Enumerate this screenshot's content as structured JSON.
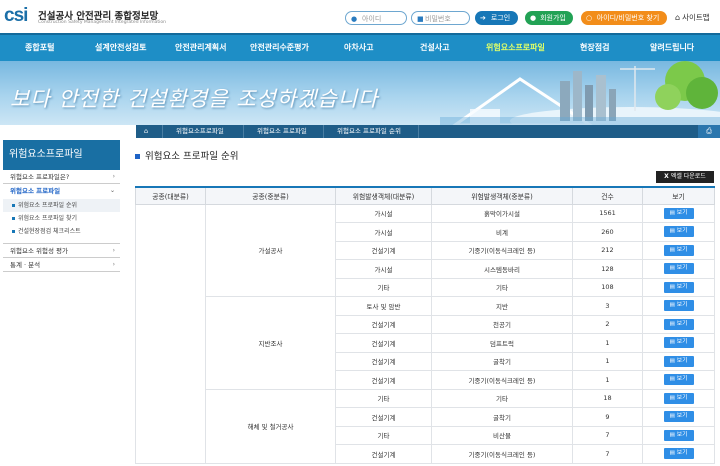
{
  "header": {
    "logo_mark": "csi",
    "title": "건설공사 안전관리 종합정보망",
    "subtitle": "Construction Safety Management Integrated Information",
    "id_placeholder": "아이디",
    "pw_placeholder": "비밀번호",
    "login_label": "로그인",
    "join_label": "회원가입",
    "find_label": "아이디/비밀번호 찾기",
    "sitemap_label": "사이트맵"
  },
  "gnb": {
    "items": [
      "종합포털",
      "설계안전성검토",
      "안전관리계획서",
      "안전관리수준평가",
      "아차사고",
      "건설사고",
      "위험요소프로파일",
      "현장점검",
      "알려드립니다"
    ],
    "active": "위험요소프로파일"
  },
  "banner": {
    "text": "보다 안전한 건설환경을 조성하겠습니다"
  },
  "breadcrumb": [
    "위험요소프로파일",
    "위험요소 프로파일",
    "위험요소 프로파일 순위"
  ],
  "lnb": {
    "title": "위험요소프로파일",
    "items": [
      {
        "label": "위험요소 프로파일은?"
      },
      {
        "label": "위험요소 프로파일"
      },
      {
        "label": "위험요소 위험성 평가"
      },
      {
        "label": "통계 · 분석"
      }
    ],
    "subitems": [
      "위험요소 프로파일 순위",
      "위험요소 프로파일 찾기",
      "건설현장점검 체크리스트"
    ]
  },
  "page": {
    "title": "위험요소 프로파일 순위",
    "excel_label": "엑셀 다운로드"
  },
  "table": {
    "headers": [
      "공종(대분류)",
      "공종(중분류)",
      "위험발생객체(대분류)",
      "위험발생객체(중분류)",
      "건수",
      "보기"
    ],
    "view_label": "보기",
    "groups": [
      {
        "name": "가설공사",
        "rows": [
          {
            "obj_major": "가시설",
            "obj_mid": "흙막이가시설",
            "count": "1561"
          },
          {
            "obj_major": "가시설",
            "obj_mid": "비계",
            "count": "260"
          },
          {
            "obj_major": "건설기계",
            "obj_mid": "기중기(이동식크레인 등)",
            "count": "212"
          },
          {
            "obj_major": "가시설",
            "obj_mid": "시스템동바리",
            "count": "128"
          },
          {
            "obj_major": "기타",
            "obj_mid": "기타",
            "count": "108"
          }
        ]
      },
      {
        "name": "지반조사",
        "rows": [
          {
            "obj_major": "토사 및 암반",
            "obj_mid": "지반",
            "count": "3"
          },
          {
            "obj_major": "건설기계",
            "obj_mid": "천공기",
            "count": "2"
          },
          {
            "obj_major": "건설기계",
            "obj_mid": "덤프트럭",
            "count": "1"
          },
          {
            "obj_major": "건설기계",
            "obj_mid": "굴착기",
            "count": "1"
          },
          {
            "obj_major": "건설기계",
            "obj_mid": "기중기(이동식크레인 등)",
            "count": "1"
          }
        ]
      },
      {
        "name": "해체 및 철거공사",
        "rows": [
          {
            "obj_major": "기타",
            "obj_mid": "기타",
            "count": "18"
          },
          {
            "obj_major": "건설기계",
            "obj_mid": "굴착기",
            "count": "9"
          },
          {
            "obj_major": "기타",
            "obj_mid": "비산물",
            "count": "7"
          },
          {
            "obj_major": "건설기계",
            "obj_mid": "기중기(이동식크레인 등)",
            "count": "7"
          }
        ]
      }
    ]
  }
}
